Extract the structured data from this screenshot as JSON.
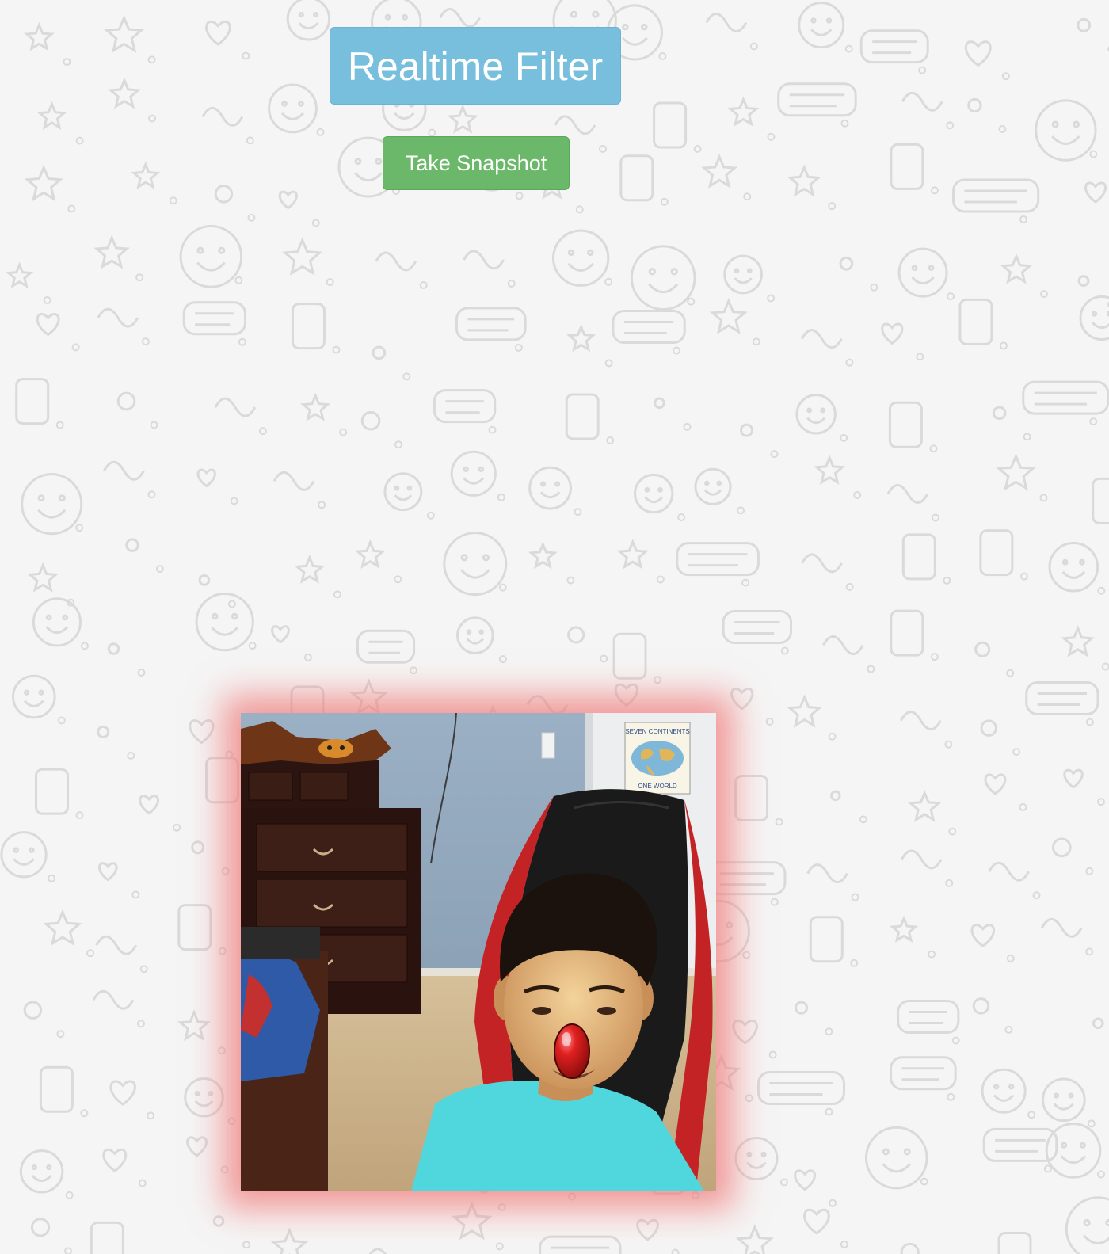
{
  "header": {
    "title": "Realtime Filter"
  },
  "controls": {
    "snapshot_label": "Take Snapshot"
  },
  "poster": {
    "line1": "SEVEN CONTINENTS",
    "line2": "ONE WORLD"
  },
  "filter": {
    "name": "red-nose",
    "glow_color": "#f07878",
    "nose_color": "#d01f1f"
  },
  "colors": {
    "title_bg": "#78bfdd",
    "button_bg": "#6cb86a",
    "page_bg": "#f5f5f5",
    "doodle_stroke": "#dadada"
  }
}
